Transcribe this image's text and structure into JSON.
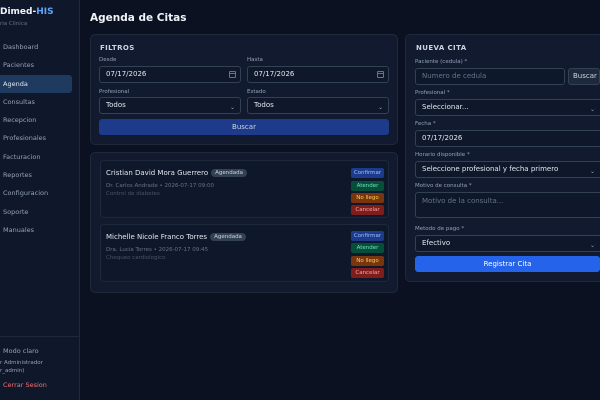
{
  "sidebar": {
    "brand_prefix": "Dimed-",
    "brand_highlight": "HIS",
    "subtitle": "ria Clinica",
    "items": [
      {
        "label": "Dashboard"
      },
      {
        "label": "Pacientes"
      },
      {
        "label": "Agenda"
      },
      {
        "label": "Consultas"
      },
      {
        "label": "Recepcion"
      },
      {
        "label": "Profesionales"
      },
      {
        "label": "Facturacion"
      },
      {
        "label": "Reportes"
      },
      {
        "label": "Configuracion"
      },
      {
        "label": "Soporte"
      },
      {
        "label": "Manuales"
      }
    ],
    "mode_label": "Modo claro",
    "user_line1": "r Administrador",
    "user_line2": "r_admin)",
    "logout_label": "Cerrar Sesion"
  },
  "page": {
    "title": "Agenda de Citas"
  },
  "filters": {
    "title": "FILTROS",
    "from_label": "Desde",
    "from_value": "07/17/2026",
    "to_label": "Hasta",
    "to_value": "07/17/2026",
    "professional_label": "Profesional",
    "professional_value": "Todos",
    "status_label": "Estado",
    "status_value": "Todos",
    "search_label": "Buscar"
  },
  "appointments": [
    {
      "patient": "Cristian David Mora Guerrero",
      "status": "Agendada",
      "meta": "Dr. Carlos Andrade • 2026-07-17 09:00",
      "reason": "Control de diabetes"
    },
    {
      "patient": "Michelle Nicole Franco Torres",
      "status": "Agendada",
      "meta": "Dra. Lucia Torres • 2026-07-17 09:45",
      "reason": "Chequeo cardiologico"
    }
  ],
  "actions": {
    "confirm": "Confirmar",
    "attend": "Atender",
    "no_show": "No llego",
    "cancel": "Cancelar"
  },
  "new_appointment": {
    "title": "NUEVA CITA",
    "patient_label": "Paciente (cedula) *",
    "patient_placeholder": "Numero de cedula",
    "search_label": "Buscar",
    "professional_label": "Profesional *",
    "professional_value": "Seleccionar...",
    "date_label": "Fecha *",
    "date_value": "07/17/2026",
    "schedule_label": "Horario disponible *",
    "schedule_value": "Seleccione profesional y fecha primero",
    "reason_label": "Motivo de consulta *",
    "reason_placeholder": "Motivo de la consulta...",
    "payment_label": "Metodo de pago *",
    "payment_value": "Efectivo",
    "submit_label": "Registrar Cita"
  },
  "colors": {
    "background": "#0b1120",
    "sidebar": "#0f172a",
    "accent": "#2563eb",
    "brand_highlight": "#60a5fa",
    "danger": "#f87171"
  }
}
